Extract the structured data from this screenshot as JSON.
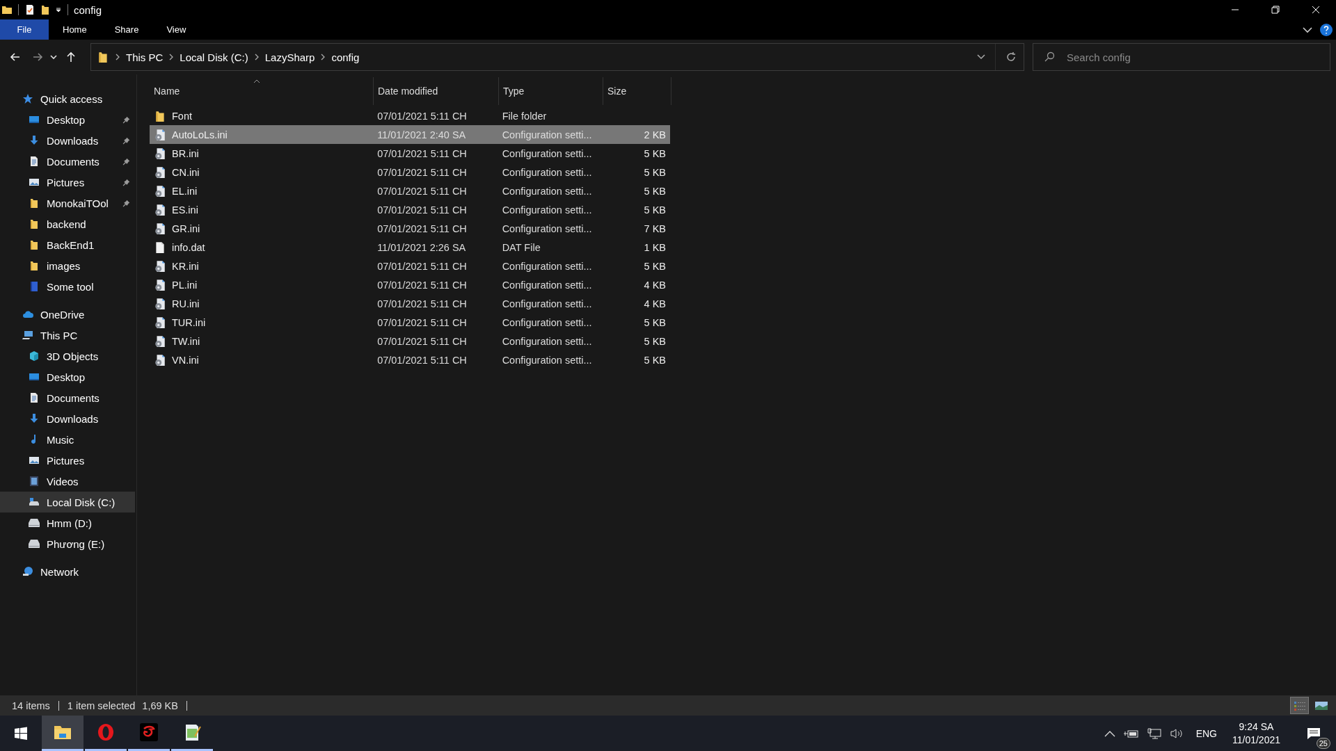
{
  "window": {
    "title": "config"
  },
  "ribbon_tabs": [
    {
      "label": "File",
      "selected": true
    },
    {
      "label": "Home",
      "selected": false
    },
    {
      "label": "Share",
      "selected": false
    },
    {
      "label": "View",
      "selected": false
    }
  ],
  "address": {
    "path": [
      "This PC",
      "Local Disk (C:)",
      "LazySharp",
      "config"
    ]
  },
  "search": {
    "placeholder": "Search config"
  },
  "sidebar": {
    "items": [
      {
        "label": "Quick access",
        "selected": false,
        "children": [
          {
            "label": "Desktop",
            "pinned": true,
            "selected": false
          },
          {
            "label": "Downloads",
            "pinned": true,
            "selected": false
          },
          {
            "label": "Documents",
            "pinned": true,
            "selected": false
          },
          {
            "label": "Pictures",
            "pinned": true,
            "selected": false
          },
          {
            "label": "MonokaiTOol",
            "pinned": true,
            "selected": false
          },
          {
            "label": "backend",
            "pinned": false,
            "selected": false
          },
          {
            "label": "BackEnd1",
            "pinned": false,
            "selected": false
          },
          {
            "label": "images",
            "pinned": false,
            "selected": false
          },
          {
            "label": "Some tool",
            "pinned": false,
            "selected": false
          }
        ]
      },
      {
        "label": "OneDrive",
        "selected": false
      },
      {
        "label": "This PC",
        "selected": false,
        "children": [
          {
            "label": "3D Objects",
            "pinned": false,
            "selected": false
          },
          {
            "label": "Desktop",
            "pinned": false,
            "selected": false
          },
          {
            "label": "Documents",
            "pinned": false,
            "selected": false
          },
          {
            "label": "Downloads",
            "pinned": false,
            "selected": false
          },
          {
            "label": "Music",
            "pinned": false,
            "selected": false
          },
          {
            "label": "Pictures",
            "pinned": false,
            "selected": false
          },
          {
            "label": "Videos",
            "pinned": false,
            "selected": false
          },
          {
            "label": "Local Disk (C:)",
            "pinned": false,
            "selected": true
          },
          {
            "label": "Hmm (D:)",
            "pinned": false,
            "selected": false
          },
          {
            "label": "Phương (E:)",
            "pinned": false,
            "selected": false
          }
        ]
      },
      {
        "label": "Network",
        "selected": false
      }
    ]
  },
  "table": {
    "columns": [
      "Name",
      "Date modified",
      "Type",
      "Size"
    ],
    "rows": [
      {
        "kind": "folder",
        "name": "Font",
        "date": "07/01/2021 5:11 CH",
        "type": "File folder",
        "selected": false
      },
      {
        "kind": "config",
        "name": "AutoLoLs.ini",
        "date": "11/01/2021 2:40 SA",
        "type": "Configuration setti...",
        "size": "2 KB",
        "selected": true
      },
      {
        "kind": "config",
        "name": "BR.ini",
        "date": "07/01/2021 5:11 CH",
        "type": "Configuration setti...",
        "size": "5 KB",
        "selected": false
      },
      {
        "kind": "config",
        "name": "CN.ini",
        "date": "07/01/2021 5:11 CH",
        "type": "Configuration setti...",
        "size": "5 KB",
        "selected": false
      },
      {
        "kind": "config",
        "name": "EL.ini",
        "date": "07/01/2021 5:11 CH",
        "type": "Configuration setti...",
        "size": "5 KB",
        "selected": false
      },
      {
        "kind": "config",
        "name": "ES.ini",
        "date": "07/01/2021 5:11 CH",
        "type": "Configuration setti...",
        "size": "5 KB",
        "selected": false
      },
      {
        "kind": "config",
        "name": "GR.ini",
        "date": "07/01/2021 5:11 CH",
        "type": "Configuration setti...",
        "size": "7 KB",
        "selected": false
      },
      {
        "kind": "file",
        "name": "info.dat",
        "date": "11/01/2021 2:26 SA",
        "type": "DAT File",
        "size": "1 KB",
        "selected": false
      },
      {
        "kind": "config",
        "name": "KR.ini",
        "date": "07/01/2021 5:11 CH",
        "type": "Configuration setti...",
        "size": "5 KB",
        "selected": false
      },
      {
        "kind": "config",
        "name": "PL.ini",
        "date": "07/01/2021 5:11 CH",
        "type": "Configuration setti...",
        "size": "4 KB",
        "selected": false
      },
      {
        "kind": "config",
        "name": "RU.ini",
        "date": "07/01/2021 5:11 CH",
        "type": "Configuration setti...",
        "size": "4 KB",
        "selected": false
      },
      {
        "kind": "config",
        "name": "TUR.ini",
        "date": "07/01/2021 5:11 CH",
        "type": "Configuration setti...",
        "size": "5 KB",
        "selected": false
      },
      {
        "kind": "config",
        "name": "TW.ini",
        "date": "07/01/2021 5:11 CH",
        "type": "Configuration setti...",
        "size": "5 KB",
        "selected": false
      },
      {
        "kind": "config",
        "name": "VN.ini",
        "date": "07/01/2021 5:11 CH",
        "type": "Configuration setti...",
        "size": "5 KB",
        "selected": false
      }
    ]
  },
  "status_bar": {
    "count": "14 items",
    "selection": "1 item selected",
    "size": "1,69 KB"
  },
  "view_buttons": [
    {
      "kind": "details",
      "selected": true
    },
    {
      "kind": "large-icons",
      "selected": false
    }
  ],
  "taskbar": {
    "apps": [
      {
        "selected": true
      },
      {
        "selected": false
      },
      {
        "selected": false
      },
      {
        "selected": false
      }
    ]
  },
  "tray": {
    "language": "ENG",
    "time": "9:24 SA",
    "date": "11/01/2021",
    "notifications": "25"
  }
}
